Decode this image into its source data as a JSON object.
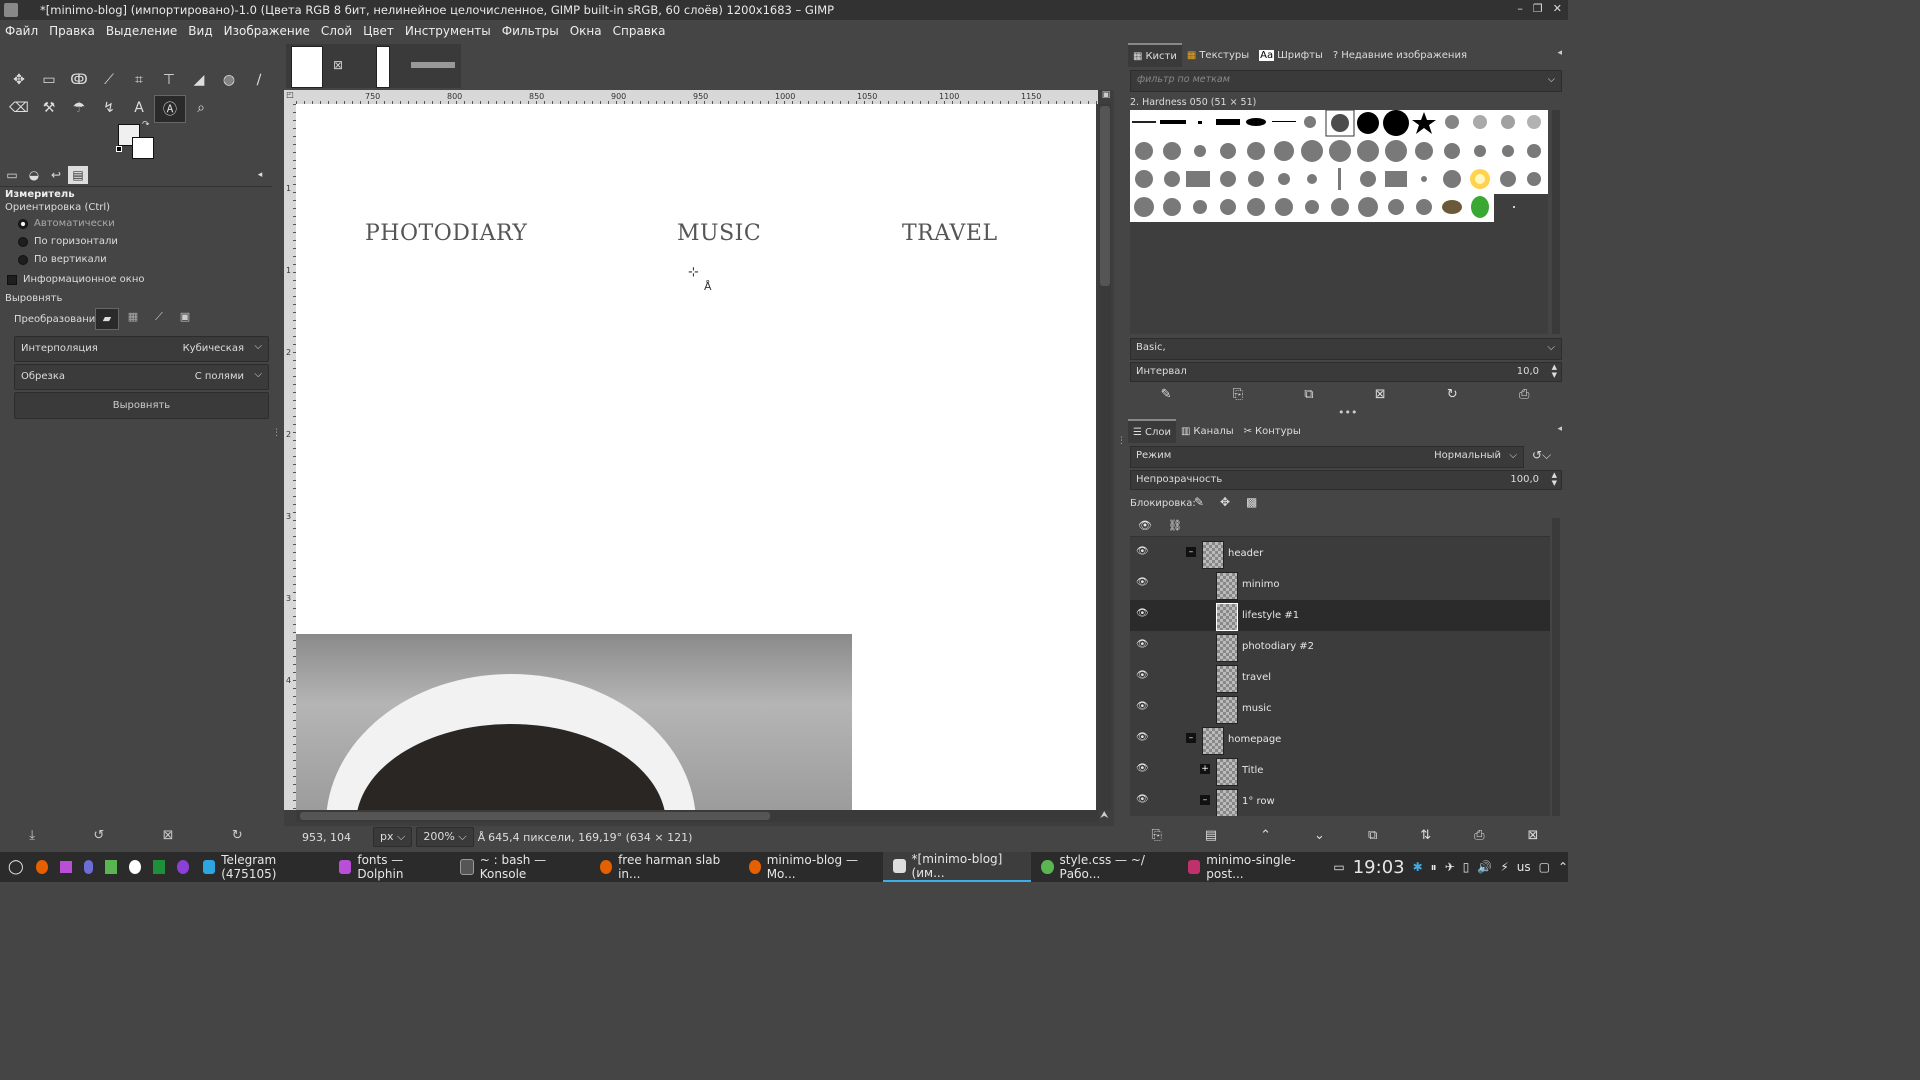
{
  "window": {
    "title": "*[minimo-blog] (импортировано)-1.0 (Цвета RGB 8 бит, нелинейное целочисленное, GIMP built-in sRGB, 60 слоёв) 1200x1683 – GIMP",
    "controls": [
      "–",
      "❐",
      "✕"
    ]
  },
  "menu": [
    "Файл",
    "Правка",
    "Выделение",
    "Вид",
    "Изображение",
    "Слой",
    "Цвет",
    "Инструменты",
    "Фильтры",
    "Окна",
    "Справка"
  ],
  "tool_options": {
    "tool_name": "Измеритель",
    "orientation_label": "Ориентировка (Ctrl)",
    "orientation_options": [
      "Автоматически",
      "По горизонтали",
      "По вертикали"
    ],
    "info_window_label": "Информационное окно",
    "align_label": "Выровнять",
    "transform_label": "Преобразование:",
    "interpolation_label": "Интерполяция",
    "interpolation_value": "Кубическая",
    "clip_label": "Обрезка",
    "clip_value": "С полями",
    "straighten_button": "Выровнять"
  },
  "canvas": {
    "ruler_ticks": [
      "750",
      "800",
      "850",
      "900",
      "950",
      "1000",
      "1050",
      "1100",
      "1150"
    ],
    "vruler_ticks": [
      "1",
      "1",
      "2",
      "2",
      "3",
      "3",
      "4"
    ],
    "nav_words": [
      "PHOTODIARY",
      "MUSIC",
      "TRAVEL"
    ]
  },
  "status": {
    "coords": "953, 104",
    "unit": "px",
    "zoom": "200%",
    "measure": "645,4 пиксели, 169,19° (634 × 121)"
  },
  "brushes_dock": {
    "tabs": [
      "Кисти",
      "Текстуры",
      "Шрифты",
      "Недавние изображения"
    ],
    "filter_placeholder": "фильтр по меткам",
    "brush_name": "2. Hardness 050 (51 × 51)",
    "tag_value": "Basic,",
    "spacing_label": "Интервал",
    "spacing_value": "10,0"
  },
  "layers_dock": {
    "tabs": [
      "Слои",
      "Каналы",
      "Контуры"
    ],
    "mode_label": "Режим",
    "mode_value": "Нормальный",
    "opacity_label": "Непрозрачность",
    "opacity_value": "100,0",
    "lock_label": "Блокировка:",
    "layers": [
      {
        "name": "header",
        "group": true
      },
      {
        "name": "minimo"
      },
      {
        "name": "lifestyle #1",
        "selected": true
      },
      {
        "name": "photodiary #2"
      },
      {
        "name": "travel"
      },
      {
        "name": "music"
      },
      {
        "name": "homepage",
        "group": true
      },
      {
        "name": "Title"
      },
      {
        "name": "1° row"
      }
    ]
  },
  "taskbar": {
    "tasks": [
      {
        "label": "Telegram (475105)",
        "color": "#2ca5e0"
      },
      {
        "label": "fonts — Dolphin",
        "color": "#b84fd6"
      },
      {
        "label": "~ : bash — Konsole",
        "color": "#555555"
      },
      {
        "label": "free harman slab in...",
        "color": "#e66000"
      },
      {
        "label": "minimo-blog — Mo...",
        "color": "#e66000"
      },
      {
        "label": "*[minimo-blog] (им...",
        "color": "#dddddd"
      },
      {
        "label": "style.css — ~/Рабо...",
        "color": "#5ab552"
      },
      {
        "label": "minimo-single-post...",
        "color": "#c0306a"
      }
    ],
    "lang": "us",
    "clock": "19:03"
  }
}
